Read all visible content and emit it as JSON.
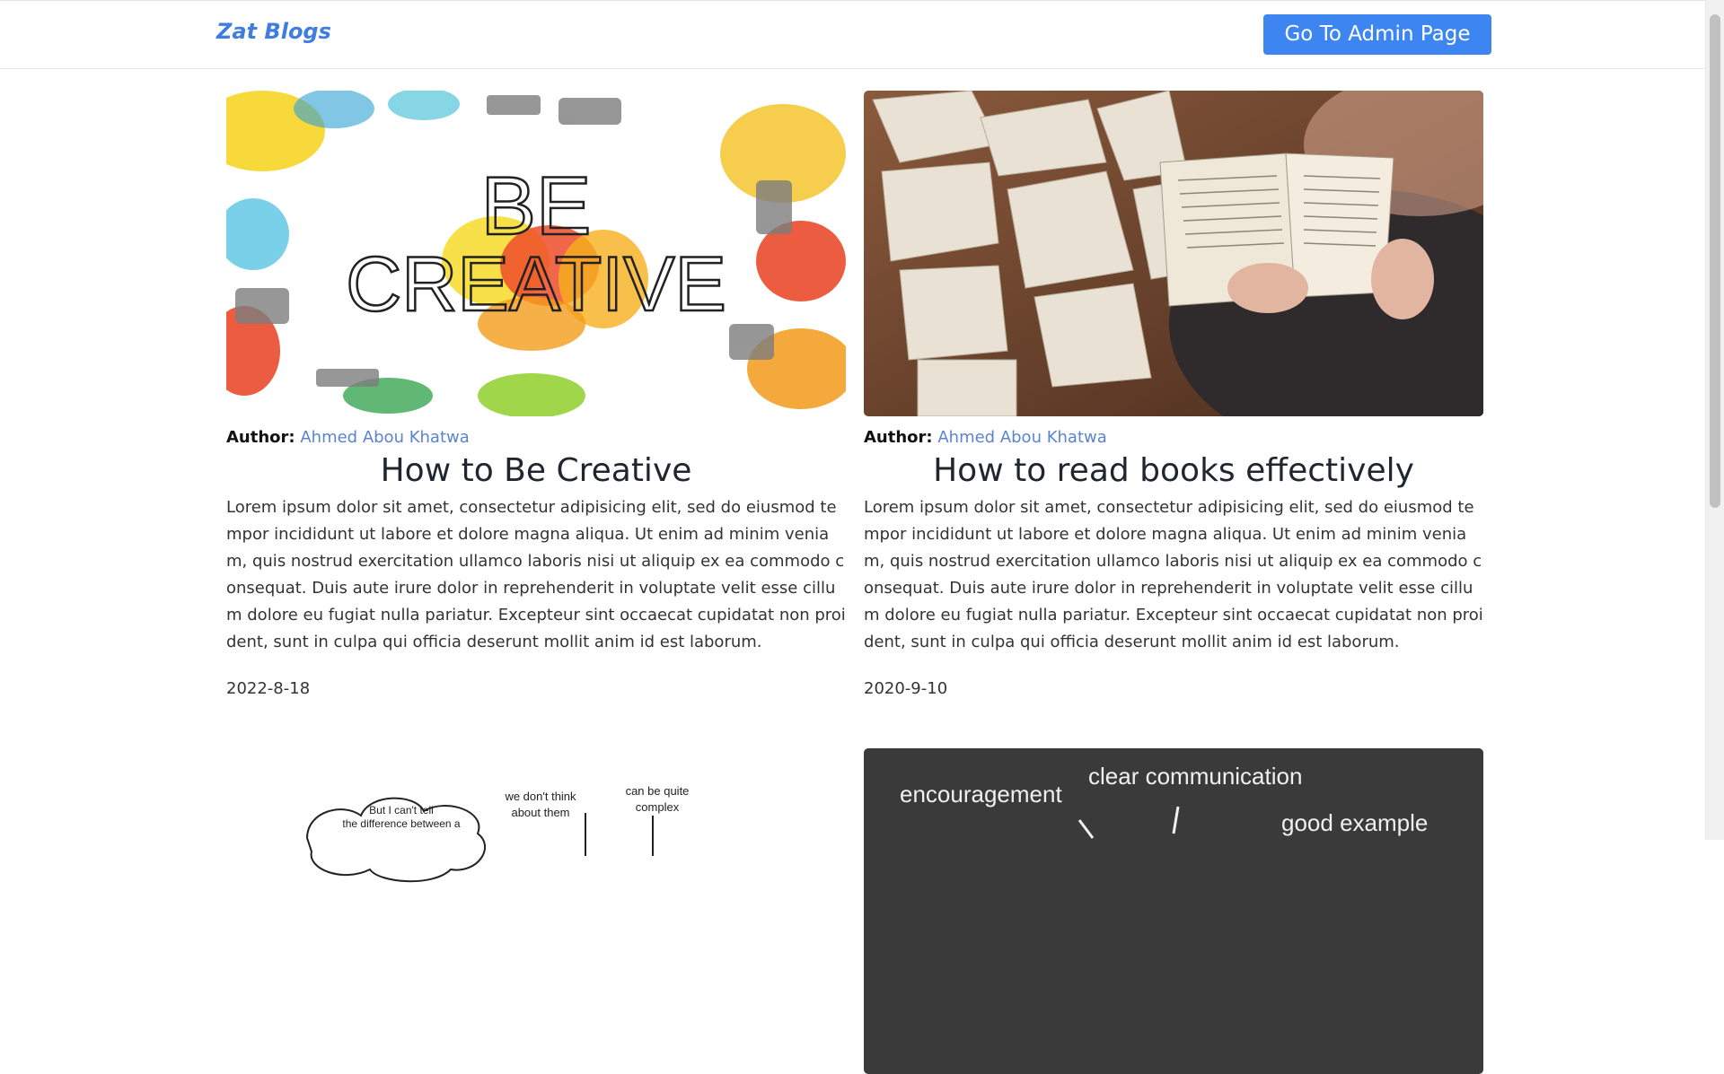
{
  "nav": {
    "brand": "Zat Blogs",
    "admin_button": "Go To Admin Page"
  },
  "posts": [
    {
      "image": "be-creative-illustration",
      "image_text": [
        "BE",
        "CREATIVE"
      ],
      "author_label": "Author:",
      "author": "Ahmed Abou Khatwa",
      "title": "How to Be Creative",
      "excerpt": "Lorem ipsum dolor sit amet, consectetur adipisicing elit, sed do eiusmod tempor incididunt ut labore et dolore magna aliqua. Ut enim ad minim veniam, quis nostrud exercitation ullamco laboris nisi ut aliquip ex ea commodo consequat. Duis aute irure dolor in reprehenderit in voluptate velit esse cillum dolore eu fugiat nulla pariatur. Excepteur sint occaecat cupidatat non proident, sunt in culpa qui officia deserunt mollit anim id est laborum.",
      "date": "2022-8-18"
    },
    {
      "image": "reading-books-photo",
      "author_label": "Author:",
      "author": "Ahmed Abou Khatwa",
      "title": "How to read books effectively",
      "excerpt": "Lorem ipsum dolor sit amet, consectetur adipisicing elit, sed do eiusmod tempor incididunt ut labore et dolore magna aliqua. Ut enim ad minim veniam, quis nostrud exercitation ullamco laboris nisi ut aliquip ex ea commodo consequat. Duis aute irure dolor in reprehenderit in voluptate velit esse cillum dolore eu fugiat nulla pariatur. Excepteur sint occaecat cupidatat non proident, sunt in culpa qui officia deserunt mollit anim id est laborum.",
      "date": "2020-9-10"
    },
    {
      "image": "thinking-sketch",
      "image_text": [
        "But I can't tell",
        "the difference between a",
        "we don't think",
        "about them",
        "can be quite",
        "complex"
      ]
    },
    {
      "image": "chalkboard",
      "image_text": [
        "clear communication",
        "encouragement",
        "good example"
      ]
    }
  ],
  "colors": {
    "brand": "#3f7de0",
    "button": "#3d86f1",
    "author_link": "#5a84d0"
  }
}
